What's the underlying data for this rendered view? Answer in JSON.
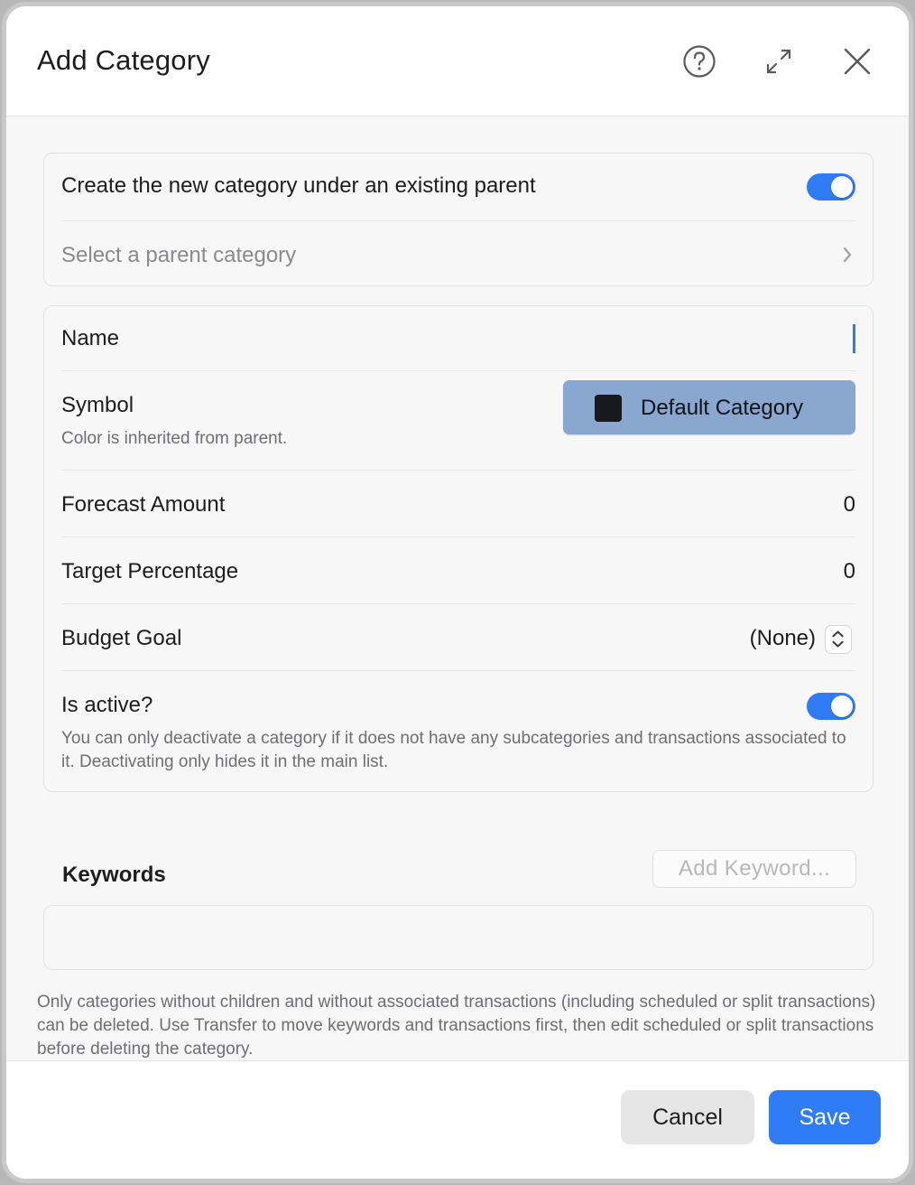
{
  "dialog": {
    "title": "Add Category"
  },
  "header_icons": [
    "help-icon",
    "expand-icon",
    "close-icon"
  ],
  "parent_section": {
    "toggle_label": "Create the new category under an existing parent",
    "toggle_on": true,
    "select_placeholder": "Select a parent category"
  },
  "fields": {
    "name_label": "Name",
    "name_value": "",
    "symbol_label": "Symbol",
    "symbol_note": "Color is inherited from parent.",
    "symbol_button": "Default Category",
    "forecast_label": "Forecast Amount",
    "forecast_value": "0",
    "target_label": "Target Percentage",
    "target_value": "0",
    "budget_label": "Budget Goal",
    "budget_value": "(None)",
    "active_label": "Is active?",
    "active_on": true,
    "active_note": "You can only deactivate a category if it does not have any subcategories and transactions associated to it. Deactivating only hides it in the main list."
  },
  "keywords": {
    "label": "Keywords",
    "add_button": "Add Keyword..."
  },
  "footer_note": "Only categories without children and without associated transactions (including scheduled or split transactions) can be deleted. Use Transfer to move keywords and transactions first, then edit scheduled or split transactions before deleting the category.",
  "buttons": {
    "cancel": "Cancel",
    "save": "Save"
  },
  "colors": {
    "accent": "#2f7cf6",
    "symbol_button_bg": "#8aa7cf",
    "swatch": "#16181c"
  }
}
